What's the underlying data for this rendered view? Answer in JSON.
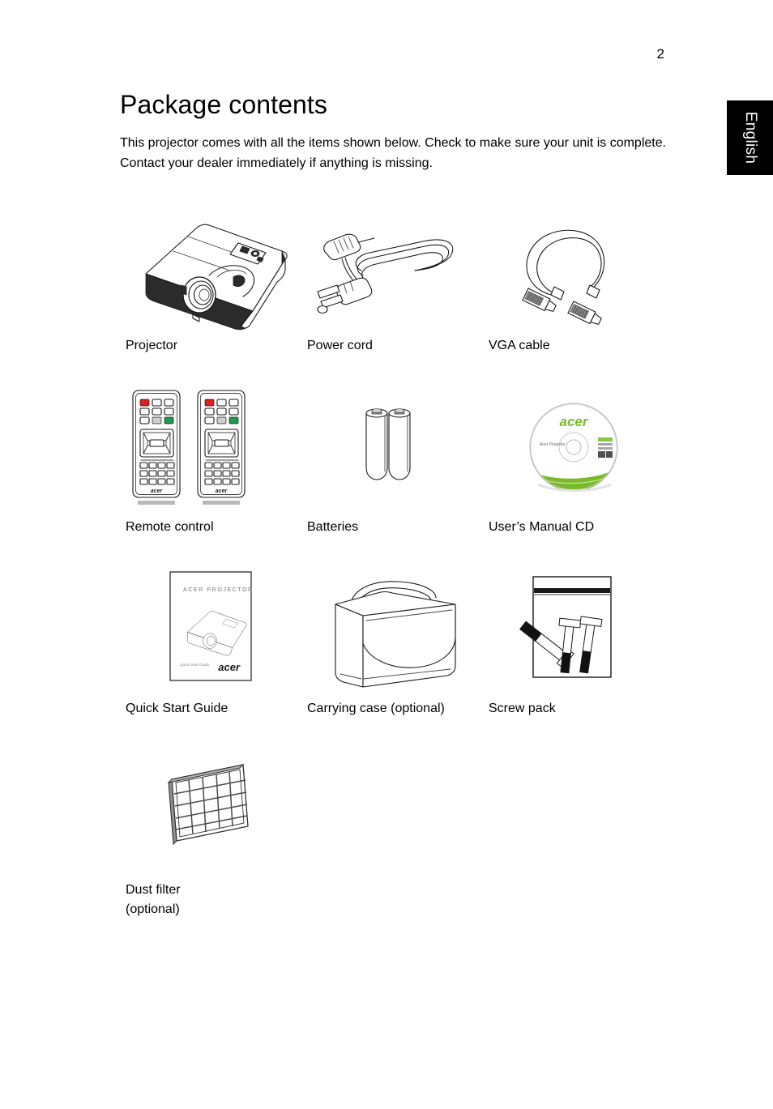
{
  "page": {
    "number": "2",
    "language_tab": "English"
  },
  "heading": {
    "title": "Package contents",
    "intro": "This projector comes with all the items shown below. Check to make sure your unit is complete. Contact your dealer immediately if anything is missing."
  },
  "items": [
    [
      {
        "caption": "Projector",
        "icon": "projector-illustration"
      },
      {
        "caption": "Power cord",
        "icon": "power-cord-illustration"
      },
      {
        "caption": "VGA cable",
        "icon": "vga-cable-illustration"
      }
    ],
    [
      {
        "caption": "Remote control",
        "icon": "remote-control-illustration"
      },
      {
        "caption": "Batteries",
        "icon": "batteries-illustration"
      },
      {
        "caption": "User’s Manual CD",
        "icon": "manual-cd-illustration"
      }
    ],
    [
      {
        "caption": "Quick Start Guide",
        "icon": "quick-start-guide-illustration"
      },
      {
        "caption": "Carrying case (optional)",
        "icon": "carrying-case-illustration"
      },
      {
        "caption": "Screw pack",
        "icon": "screw-pack-illustration"
      }
    ],
    [
      {
        "caption": "Dust filter\n(optional)",
        "icon": "dust-filter-illustration"
      }
    ]
  ],
  "artwork_labels": {
    "cd_brand": "acer",
    "cd_subtitle": "Acer Projector",
    "guide_title": "ACER PROJECTOR",
    "guide_footer": "Quick Start Guide",
    "guide_brand": "acer",
    "remote_brand": "acer"
  },
  "colors": {
    "ink": "#1a1a1a",
    "tab_background": "#000000",
    "tab_text": "#ffffff",
    "acer_green": "#7ab929",
    "remote_power_red": "#e02020",
    "remote_green_key": "#1f9a4d",
    "page_background": "#ffffff"
  }
}
